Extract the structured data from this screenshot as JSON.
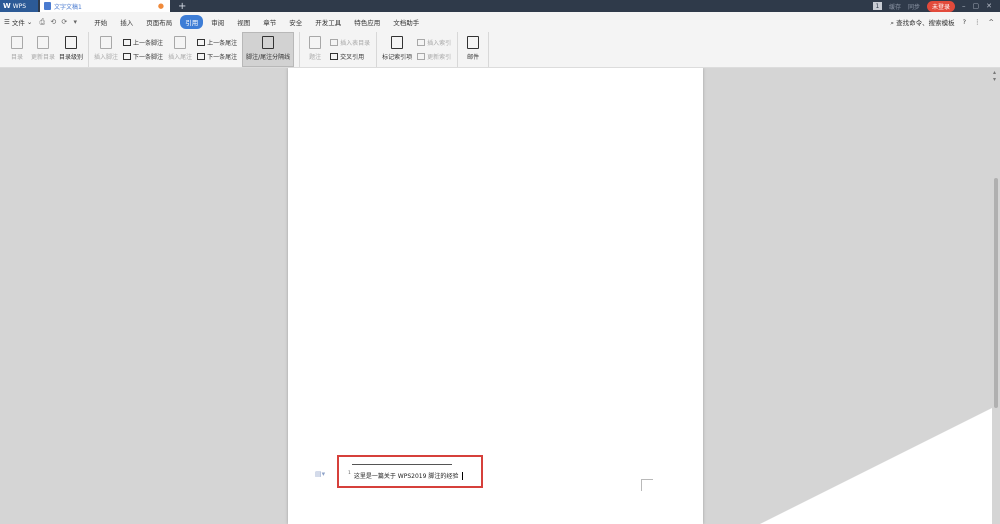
{
  "titlebar": {
    "app_label": "WPS",
    "doc_tab_label": "文字文稿1",
    "new_tab": "+",
    "badge": "1",
    "right_items": [
      "缓存",
      "同步"
    ],
    "login_label": "未登录",
    "window_controls": [
      "–",
      "▢",
      "✕"
    ]
  },
  "menubar": {
    "file_label": "文件",
    "quick_access": [
      "⎙",
      "⟲",
      "⟳",
      "▾"
    ],
    "items": [
      "开始",
      "插入",
      "页面布局",
      "引用",
      "审阅",
      "视图",
      "章节",
      "安全",
      "开发工具",
      "特色应用",
      "文档助手"
    ],
    "active_index": 3,
    "search_label": "查找命令、搜索模板",
    "help": "?",
    "more": "⋮",
    "collapse": "^"
  },
  "ribbon": {
    "toc": "目录",
    "update_toc": "更新目录",
    "toc_level": "目录级别",
    "insert_footnote": "插入脚注",
    "prev_footnote": "上一条脚注",
    "next_footnote": "下一条脚注",
    "insert_endnote": "插入尾注",
    "prev_endnote": "上一条尾注",
    "next_endnote": "下一条尾注",
    "separator_line": "脚注/尾注分隔线",
    "caption": "题注",
    "insert_table_of_figures": "插入表目录",
    "cross_reference": "交叉引用",
    "mark_index": "标记索引项",
    "insert_index": "插入索引",
    "update_index": "更新索引",
    "mail": "邮件"
  },
  "document": {
    "footnote_number": "1",
    "footnote_text": "这里是一篇关于 WPS2019 脚注的经验"
  },
  "colors": {
    "titlebar": "#2f3a4a",
    "accent": "#3d7dd6",
    "highlight_box": "#d6403b",
    "login": "#e24a3b"
  }
}
